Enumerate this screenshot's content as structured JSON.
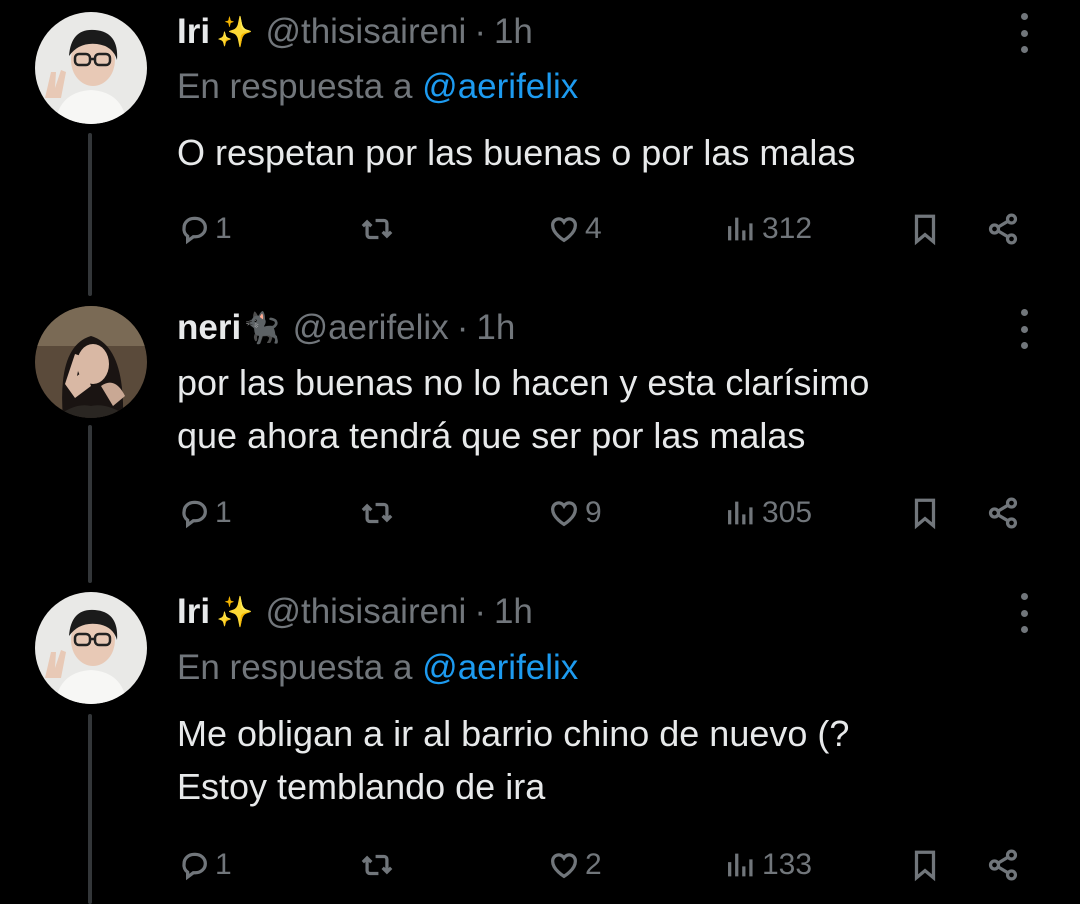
{
  "tweets": [
    {
      "name": "Iri",
      "emoji": "✨",
      "handle": "@thisisaireni",
      "time": "1h",
      "reply_prefix": "En respuesta a",
      "reply_mention": "@aerifelix",
      "text": "O respetan por las buenas o por las malas",
      "replies": "1",
      "retweets": "",
      "likes": "4",
      "views": "312"
    },
    {
      "name": "neri",
      "emoji": "🐈‍⬛",
      "handle": "@aerifelix",
      "time": "1h",
      "text": "por las buenas no lo hacen y esta clarísimo\nque ahora tendrá que ser por las malas",
      "replies": "1",
      "retweets": "",
      "likes": "9",
      "views": "305"
    },
    {
      "name": "Iri",
      "emoji": "✨",
      "handle": "@thisisaireni",
      "time": "1h",
      "reply_prefix": "En respuesta a",
      "reply_mention": "@aerifelix",
      "text": "Me obligan a ir al barrio chino de nuevo (?\nEstoy temblando de ira",
      "replies": "1",
      "retweets": "",
      "likes": "2",
      "views": "133"
    }
  ],
  "icons": {
    "reply": "reply-icon",
    "retweet": "retweet-icon",
    "like": "heart-icon",
    "views": "views-icon",
    "bookmark": "bookmark-icon",
    "share": "share-icon",
    "more": "more-options-icon"
  },
  "colors": {
    "background": "#000000",
    "text": "#e7e9ea",
    "muted": "#71767b",
    "mention": "#1d9bf0",
    "thread_line": "#333639"
  }
}
